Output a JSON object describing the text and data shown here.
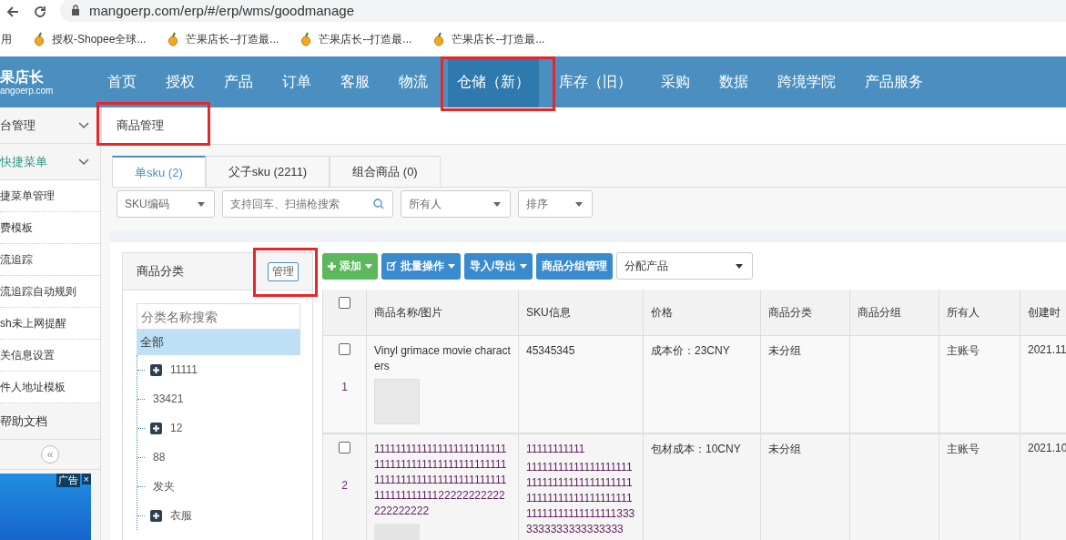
{
  "browser": {
    "url": "mangoerp.com/erp/#/erp/wms/goodmanage",
    "bookmarks": [
      "用",
      "授权-Shopee全球...",
      "芒果店长--打造最...",
      "芒果店长--打造最...",
      "芒果店长--打造最..."
    ]
  },
  "nav": {
    "logo": "果店长",
    "logo_sub": "angoerp.com",
    "items": [
      {
        "label": "首页",
        "selected": false
      },
      {
        "label": "授权",
        "selected": false
      },
      {
        "label": "产品",
        "selected": false
      },
      {
        "label": "订单",
        "selected": false
      },
      {
        "label": "客服",
        "selected": false
      },
      {
        "label": "物流",
        "selected": false
      },
      {
        "label": "仓储（新）",
        "selected": true
      },
      {
        "label": "库存（旧）",
        "selected": false
      },
      {
        "label": "采购",
        "selected": false
      },
      {
        "label": "数据",
        "selected": false
      },
      {
        "label": "跨境学院",
        "selected": false
      },
      {
        "label": "产品服务",
        "selected": false
      }
    ]
  },
  "sidebar": {
    "items": [
      {
        "kind": "section",
        "label": "台管理",
        "selected": false
      },
      {
        "kind": "section",
        "label": "快捷菜单",
        "selected": true
      },
      {
        "kind": "item",
        "label": "捷菜单管理",
        "selected": false
      },
      {
        "kind": "item",
        "label": "费模板",
        "selected": false
      },
      {
        "kind": "item",
        "label": "流追踪",
        "selected": false
      },
      {
        "kind": "item",
        "label": "流追踪自动规则",
        "selected": false
      },
      {
        "kind": "item",
        "label": "sh未上网提醒",
        "selected": false
      },
      {
        "kind": "item",
        "label": "关信息设置",
        "selected": false
      },
      {
        "kind": "item",
        "label": "件人地址模板",
        "selected": false
      },
      {
        "kind": "section",
        "label": "帮助文档",
        "selected": false
      }
    ],
    "collapse": "«",
    "ad": {
      "label": "广告",
      "close": "×"
    }
  },
  "breadcrumb": "商品管理",
  "tabs": [
    {
      "label": "单sku (2)",
      "selected": true
    },
    {
      "label": "父子sku (2211)",
      "selected": false
    },
    {
      "label": "组合商品 (0)",
      "selected": false
    }
  ],
  "filters": {
    "sku_select": "SKU编码",
    "search": {
      "placeholder": "支持回车、扫描枪搜索"
    },
    "owner_select": "所有人",
    "sort_select": "排序"
  },
  "category": {
    "title": "商品分类",
    "manage": "管理",
    "search": {
      "placeholder": "分类名称搜索"
    },
    "tree": [
      {
        "label": "全部",
        "selected": true,
        "children": [
          {
            "label": "11111",
            "selected": false,
            "expandable": true
          },
          {
            "label": "33421",
            "selected": false,
            "expandable": false
          },
          {
            "label": "12",
            "selected": false,
            "expandable": true
          },
          {
            "label": "88",
            "selected": false,
            "expandable": false
          },
          {
            "label": "发夹",
            "selected": false,
            "expandable": false
          },
          {
            "label": "衣服",
            "selected": false,
            "expandable": true
          }
        ]
      }
    ]
  },
  "toolbar": {
    "buttons": [
      {
        "label": "添加",
        "kind": "add",
        "caret": true
      },
      {
        "label": "批量操作",
        "kind": "batch",
        "caret": true
      },
      {
        "label": "导入/导出",
        "kind": "transfer",
        "caret": true
      },
      {
        "label": "商品分组管理",
        "kind": "group",
        "caret": false
      }
    ],
    "assign_select": "分配产品"
  },
  "table": {
    "all_checked": false,
    "columns": [
      "商品名称/图片",
      "SKU信息",
      "价格",
      "商品分类",
      "商品分组",
      "所有人",
      "创建时"
    ],
    "rows": [
      {
        "number": "1",
        "checked": false,
        "name": "Vinyl grimace movie characters",
        "image": {
          "kind": "photo"
        },
        "sku": [
          "45345345"
        ],
        "price": "成本价：23CNY",
        "category": "未分组",
        "owner": "主账号",
        "created": "2021.11"
      },
      {
        "number": "2",
        "checked": false,
        "name": "11111111111111111111111111111111111111111111111111111111111111111111111111111111111111122222222222222222222",
        "image": {
          "kind": "placeholder"
        },
        "sku": [
          "11111111111",
          "111111111111111111111111111111111111111111111111111111111111111111111111111113333333333333333333"
        ],
        "price": "包材成本：10CNY",
        "category": "未分组",
        "owner": "主账号",
        "created": "2021.10"
      }
    ]
  }
}
